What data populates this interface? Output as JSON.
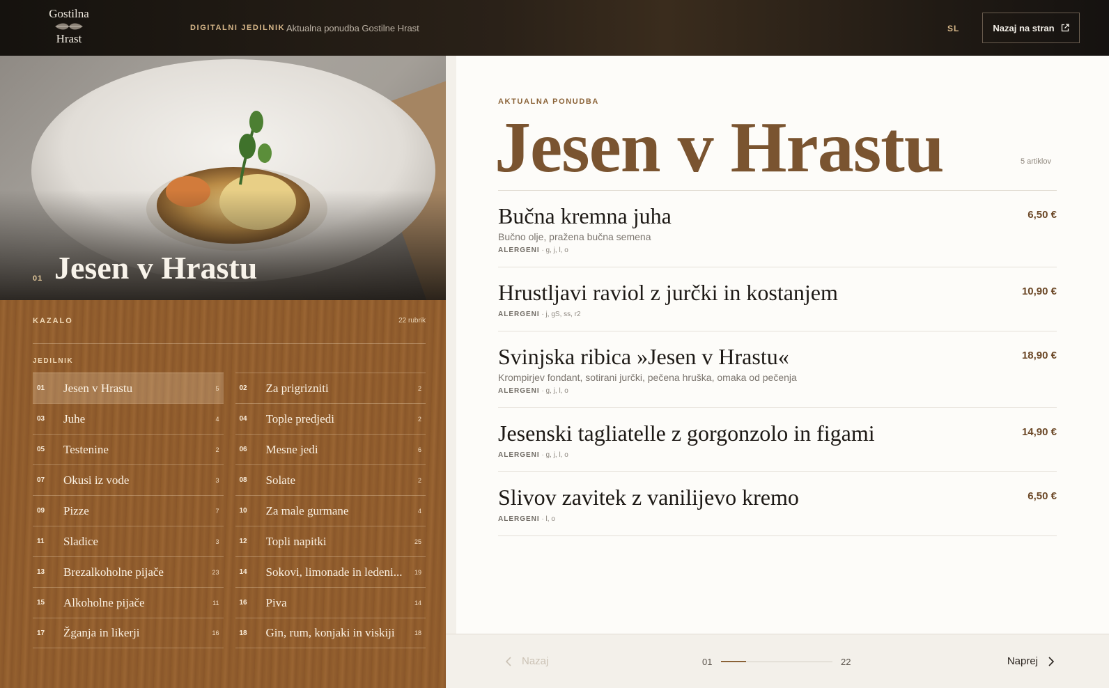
{
  "header": {
    "logo_line1": "Gostilna",
    "logo_line2": "Hrast",
    "nav_label": "DIGITALNI JEDILNIK",
    "nav_subtitle": "Aktualna ponudba Gostilne Hrast",
    "language": "SL",
    "back_button": "Nazaj na stran"
  },
  "hero": {
    "number": "01",
    "title": "Jesen v Hrastu"
  },
  "index": {
    "heading": "KAZALO",
    "count": "22 rubrik",
    "group": "JEDILNIK",
    "categories": [
      {
        "num": "01",
        "name": "Jesen v Hrastu",
        "count": "5"
      },
      {
        "num": "02",
        "name": "Za prigrizniti",
        "count": "2"
      },
      {
        "num": "03",
        "name": "Juhe",
        "count": "4"
      },
      {
        "num": "04",
        "name": "Tople predjedi",
        "count": "2"
      },
      {
        "num": "05",
        "name": "Testenine",
        "count": "2"
      },
      {
        "num": "06",
        "name": "Mesne jedi",
        "count": "6"
      },
      {
        "num": "07",
        "name": "Okusi iz vode",
        "count": "3"
      },
      {
        "num": "08",
        "name": "Solate",
        "count": "2"
      },
      {
        "num": "09",
        "name": "Pizze",
        "count": "7"
      },
      {
        "num": "10",
        "name": "Za male gurmane",
        "count": "4"
      },
      {
        "num": "11",
        "name": "Sladice",
        "count": "3"
      },
      {
        "num": "12",
        "name": "Topli napitki",
        "count": "25"
      },
      {
        "num": "13",
        "name": "Brezalkoholne pijače",
        "count": "23"
      },
      {
        "num": "14",
        "name": "Sokovi, limonade in ledeni...",
        "count": "19"
      },
      {
        "num": "15",
        "name": "Alkoholne pijače",
        "count": "11"
      },
      {
        "num": "16",
        "name": "Piva",
        "count": "14"
      },
      {
        "num": "17",
        "name": "Žganja in likerji",
        "count": "16"
      },
      {
        "num": "18",
        "name": "Gin, rum, konjaki in viskiji",
        "count": "18"
      }
    ]
  },
  "menu": {
    "eyebrow": "AKTUALNA PONUDBA",
    "title": "Jesen v Hrastu",
    "articles": "5 artiklov",
    "allergen_label": "ALERGENI",
    "items": [
      {
        "name": "Bučna kremna juha",
        "price": "6,50 €",
        "description": "Bučno olje, pražena bučna semena",
        "allergens": "· g, j, l, o"
      },
      {
        "name": "Hrustljavi raviol z jurčki in kostanjem",
        "price": "10,90 €",
        "description": "",
        "allergens": "· j, gS, ss, r2"
      },
      {
        "name": "Svinjska ribica »Jesen v Hrastu«",
        "price": "18,90 €",
        "description": "Krompirjev fondant, sotirani jurčki, pečena hruška, omaka od pečenja",
        "allergens": "· g, j, l, o"
      },
      {
        "name": "Jesenski tagliatelle z gorgonzolo in figami",
        "price": "14,90 €",
        "description": "",
        "allergens": "· g, j, l, o"
      },
      {
        "name": "Slivov zavitek z vanilijevo kremo",
        "price": "6,50 €",
        "description": "",
        "allergens": "· l, o"
      }
    ]
  },
  "pager": {
    "prev": "Nazaj",
    "current": "01",
    "total": "22",
    "next": "Naprej",
    "progress": 0.045
  },
  "colors": {
    "accent": "#8a6237",
    "title_brown": "#7a5430",
    "wood": "#8d5a2a"
  }
}
